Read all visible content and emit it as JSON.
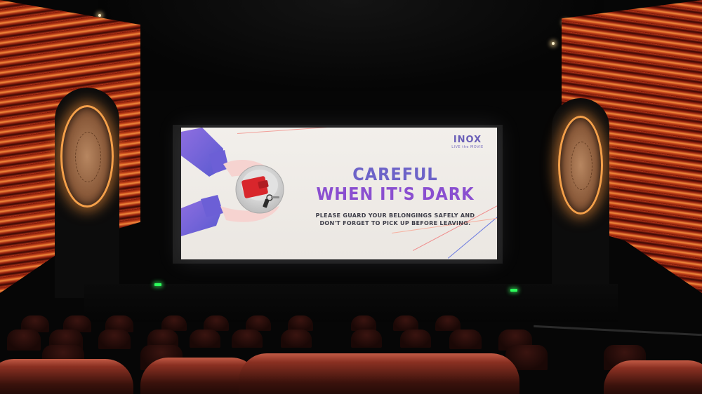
{
  "screen": {
    "logo": {
      "brand": "INOX",
      "tagline": "LIVE the MOVIE"
    },
    "headline_line1": "CAREFUL",
    "headline_line2": "WHEN IT'S DARK",
    "subline_line1": "PLEASE GUARD YOUR BELONGINGS SAFELY AND",
    "subline_line2": "DON'T FORGET TO PICK UP BEFORE LEAVING.",
    "illustration": "hands-holding-bowl-with-wallet-and-keys-icon"
  },
  "colors": {
    "headline_primary": "#6d63c8",
    "headline_secondary": "#8a4fd0",
    "wall_red": "#c2421a",
    "sconce_glow": "#f4a04a",
    "exit_light": "#2cff5c",
    "seat_red": "#c25a44"
  }
}
